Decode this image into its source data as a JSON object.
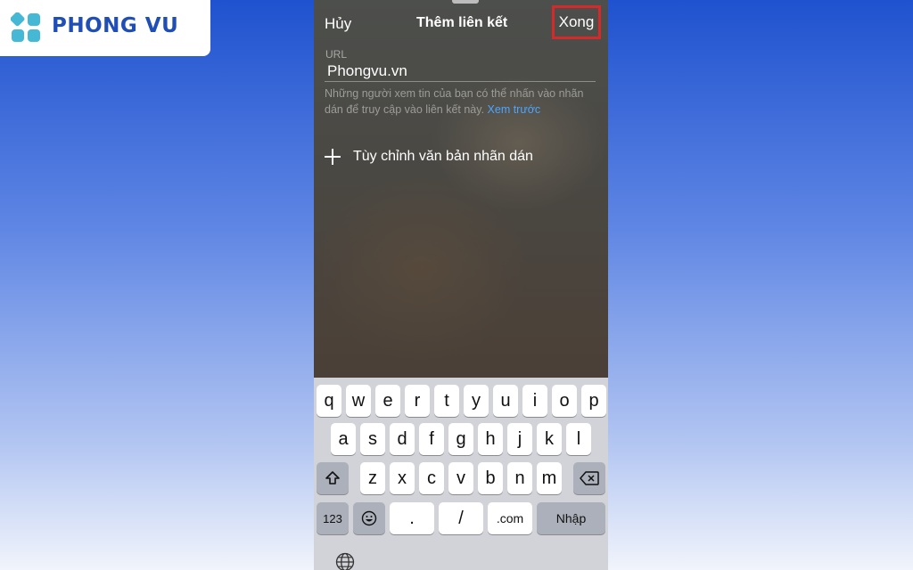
{
  "brand": {
    "name": "PHONG VU"
  },
  "nav": {
    "cancel": "Hủy",
    "title": "Thêm liên kết",
    "done": "Xong"
  },
  "url": {
    "label": "URL",
    "value": "Phongvu.vn"
  },
  "helper": {
    "text": "Những người xem tin của bạn có thể nhấn vào nhãn dán để truy cập vào liên kết này. ",
    "link": "Xem trước"
  },
  "custom_text": {
    "label": "Tùy chỉnh văn bản nhãn dán"
  },
  "keyboard": {
    "row1": [
      "q",
      "w",
      "e",
      "r",
      "t",
      "y",
      "u",
      "i",
      "o",
      "p"
    ],
    "row2": [
      "a",
      "s",
      "d",
      "f",
      "g",
      "h",
      "j",
      "k",
      "l"
    ],
    "row3": [
      "z",
      "x",
      "c",
      "v",
      "b",
      "n",
      "m"
    ],
    "numbers": "123",
    "dot": ".",
    "slash": "/",
    "dotcom": ".com",
    "enter": "Nhập"
  },
  "colors": {
    "highlight": "#d62a2a",
    "link": "#4aa6ff",
    "brand": "#1f4fb6"
  }
}
